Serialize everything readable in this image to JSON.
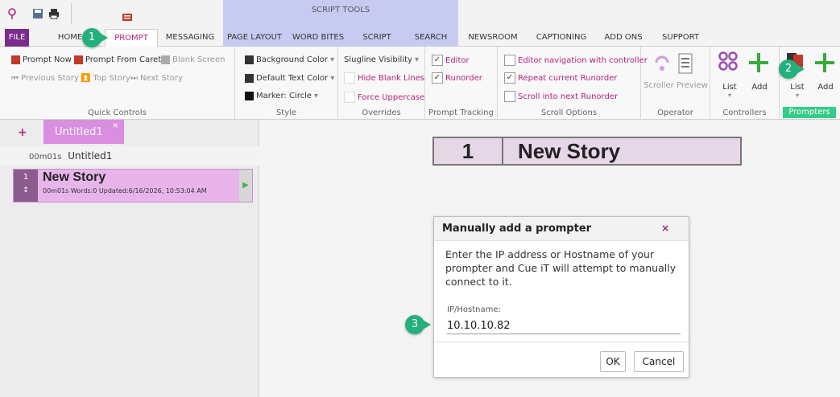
{
  "script_tools": {
    "label": "SCRIPT TOOLS"
  },
  "tabs": [
    {
      "label": "FILE"
    },
    {
      "label": "HOME"
    },
    {
      "label": "PROMPT"
    },
    {
      "label": "MESSAGING"
    },
    {
      "label": "PAGE LAYOUT"
    },
    {
      "label": "WORD BITES"
    },
    {
      "label": "SCRIPT"
    },
    {
      "label": "SEARCH"
    },
    {
      "label": "NEWSROOM"
    },
    {
      "label": "CAPTIONING"
    },
    {
      "label": "ADD ONS"
    },
    {
      "label": "SUPPORT"
    }
  ],
  "ribbon": {
    "quick_controls": {
      "prompt_now": "Prompt Now",
      "prompt_from_caret": "Prompt From Caret",
      "blank_screen": "Blank Screen",
      "previous_story": "Previous Story",
      "top_story": "Top Story",
      "next_story": "Next Story",
      "label": "Quick Controls"
    },
    "style": {
      "background_color": "Background Color",
      "default_text_color": "Default Text Color",
      "marker": "Marker: Circle",
      "label": "Style"
    },
    "overrides": {
      "slugline_visibility": "Slugline Visibility",
      "hide_blank_lines": "Hide Blank Lines",
      "force_uppercase": "Force Uppercase",
      "label": "Overrides"
    },
    "prompt_tracking": {
      "editor": "Editor",
      "runorder": "Runorder",
      "label": "Prompt Tracking"
    },
    "scroll_options": {
      "editor_navigation": "Editor navigation with controller",
      "repeat_runorder": "Repeat current Runorder",
      "scroll_next": "Scroll into next Runorder",
      "label": "Scroll Options"
    },
    "operator": {
      "scroller_preview": "Scroller Preview",
      "label": "Operator"
    },
    "controllers": {
      "list": "List",
      "add": "Add",
      "label": "Controllers"
    },
    "prompters": {
      "list": "List",
      "add": "Add",
      "label": "Prompters"
    }
  },
  "left_panel": {
    "plus": "+",
    "doc_tab": "Untitled1",
    "doc_tab_close": "×",
    "doc_duration": "00m01s",
    "doc_name": "Untitled1",
    "story": {
      "number": "1",
      "arrows": "↕",
      "title": "New Story",
      "meta": "00m01s  Words:0  Updated:6/16/2026, 10:53:04 AM",
      "play": "▶"
    }
  },
  "editor": {
    "story_number": "1",
    "story_title": "New Story"
  },
  "dialog": {
    "title": "Manually add a prompter",
    "close": "×",
    "message": "Enter the IP address or Hostname of your prompter and Cue iT will attempt to manually connect to it.",
    "field_label": "IP/Hostname:",
    "field_value": "10.10.10.82",
    "ok": "OK",
    "cancel": "Cancel"
  },
  "callouts": [
    "1",
    "2",
    "3"
  ],
  "colors": {
    "accent": "#b5247a",
    "file_tab": "#7a2b8c",
    "callout": "#24b07c",
    "prompters_group": "#33cc88"
  }
}
